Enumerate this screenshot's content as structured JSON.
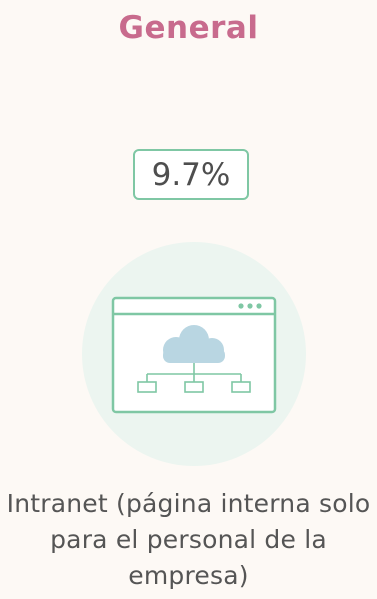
{
  "header": {
    "title": "General",
    "title_color": "#c86b8d"
  },
  "stat": {
    "value": "9.7%",
    "border_color": "#7fc7a4"
  },
  "illustration": {
    "icon": "intranet-network-icon",
    "circle_color": "#ecf5f0",
    "frame_color": "#7fc7a4",
    "cloud_color": "#b9d6e2"
  },
  "caption": {
    "text": "Intranet (página interna solo para el personal de la empresa)"
  }
}
